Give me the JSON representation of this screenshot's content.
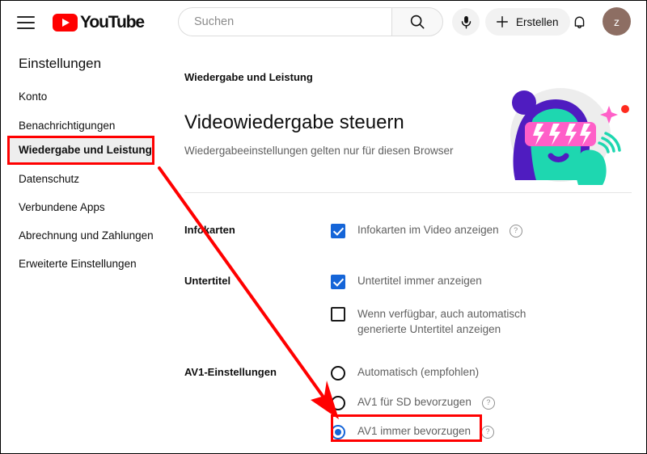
{
  "header": {
    "menu_icon": "hamburger-menu-icon",
    "logo_text": "YouTube",
    "search": {
      "placeholder": "Suchen",
      "value": "",
      "search_icon": "search-icon"
    },
    "mic_icon": "microphone-icon",
    "create_label": "Erstellen",
    "create_icon": "plus-icon",
    "notifications_icon": "bell-icon",
    "avatar_initial": "z",
    "avatar_color": "#8d6e63"
  },
  "sidebar": {
    "title": "Einstellungen",
    "items": [
      {
        "label": "Konto",
        "active": false
      },
      {
        "label": "Benachrichtigungen",
        "active": false
      },
      {
        "label": "Wiedergabe und Leistung",
        "active": true
      },
      {
        "label": "Datenschutz",
        "active": false
      },
      {
        "label": "Verbundene Apps",
        "active": false
      },
      {
        "label": "Abrechnung und Zahlungen",
        "active": false
      },
      {
        "label": "Erweiterte Einstellungen",
        "active": false
      }
    ]
  },
  "main": {
    "breadcrumb": "Wiedergabe und Leistung",
    "heading": "Videowiedergabe steuern",
    "subtitle": "Wiedergabeeinstellungen gelten nur für diesen Browser",
    "illustration_name": "person-with-lightning-sunglasses-illustration",
    "sections": [
      {
        "label": "Infokarten",
        "options": [
          {
            "type": "checkbox",
            "state": "checked",
            "label": "Infokarten im Video anzeigen",
            "help": "?"
          }
        ]
      },
      {
        "label": "Untertitel",
        "options": [
          {
            "type": "checkbox",
            "state": "checked",
            "label": "Untertitel immer anzeigen",
            "help": ""
          },
          {
            "type": "checkbox",
            "state": "unchecked",
            "label": "Wenn verfügbar, auch automatisch generierte Untertitel anzeigen",
            "help": ""
          }
        ]
      },
      {
        "label": "AV1-Einstellungen",
        "options": [
          {
            "type": "radio",
            "state": "off",
            "label": "Automatisch (empfohlen)",
            "help": ""
          },
          {
            "type": "radio",
            "state": "off",
            "label": "AV1 für SD bevorzugen",
            "help": "?"
          },
          {
            "type": "radio",
            "state": "on",
            "label": "AV1 immer bevorzugen",
            "help": "?"
          }
        ]
      }
    ]
  },
  "annotations": {
    "color": "#ff0000",
    "highlight_sidebar_item": "Wiedergabe und Leistung",
    "highlight_option": "AV1 immer bevorzugen",
    "arrow": "red-arrow-pointing-to-av1-immer-bevorzugen"
  }
}
